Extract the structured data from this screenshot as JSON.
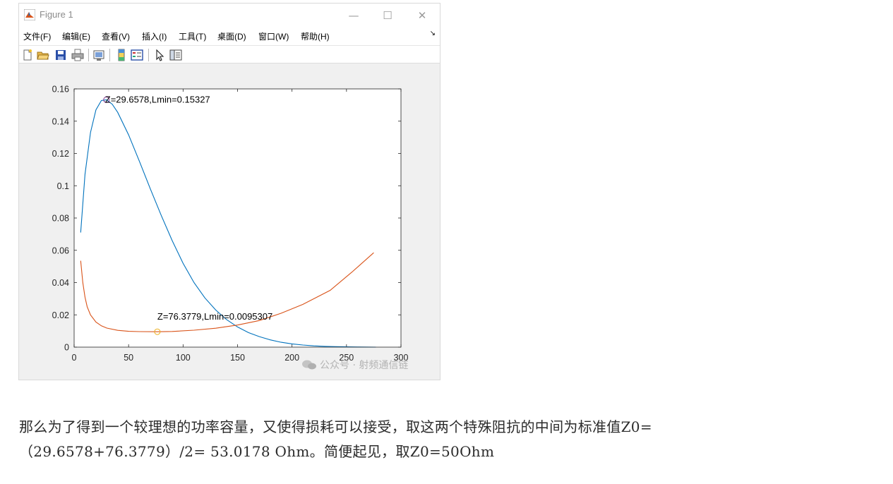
{
  "window": {
    "title": "Figure 1",
    "controls": {
      "minimize": "—",
      "maximize": "☐",
      "close": "✕"
    }
  },
  "menubar": {
    "items": [
      "文件(F)",
      "编辑(E)",
      "查看(V)",
      "插入(I)",
      "工具(T)",
      "桌面(D)",
      "窗口(W)",
      "帮助(H)"
    ],
    "dock_symbol": "↘"
  },
  "toolbar": {
    "icons": [
      "new-figure-icon",
      "open-file-icon",
      "save-icon",
      "print-icon",
      "link-plot-icon",
      "colorbar-icon",
      "legend-icon",
      "pointer-icon",
      "property-editor-icon"
    ]
  },
  "chart_data": {
    "type": "line",
    "title": "",
    "xlabel": "",
    "ylabel": "",
    "xlim": [
      0,
      300
    ],
    "ylim": [
      0,
      0.16
    ],
    "xticks": [
      "0",
      "50",
      "100",
      "150",
      "200",
      "250",
      "300"
    ],
    "yticks": [
      "0",
      "0.02",
      "0.04",
      "0.06",
      "0.08",
      "0.1",
      "0.12",
      "0.14",
      "0.16"
    ],
    "grid": false,
    "series": [
      {
        "color": "#0072bd",
        "x": [
          6,
          10,
          15,
          20,
          25,
          29.66,
          35,
          40,
          50,
          60,
          70,
          80,
          90,
          100,
          110,
          120,
          130,
          140,
          150,
          160,
          170,
          180,
          190,
          200,
          210,
          220,
          230,
          240,
          250,
          260,
          277
        ],
        "y": [
          0.071,
          0.107,
          0.133,
          0.147,
          0.1528,
          0.15327,
          0.1505,
          0.1455,
          0.1315,
          0.115,
          0.098,
          0.0815,
          0.066,
          0.052,
          0.04,
          0.0305,
          0.023,
          0.017,
          0.0125,
          0.009,
          0.0065,
          0.0045,
          0.003,
          0.002,
          0.0013,
          0.0008,
          0.0005,
          0.0003,
          0.0002,
          0.0001,
          0.0
        ]
      },
      {
        "color": "#d95319",
        "x": [
          6,
          8,
          10,
          12,
          15,
          20,
          25,
          30,
          40,
          50,
          60,
          76.38,
          90,
          110,
          130,
          150,
          170,
          190,
          210,
          235,
          255,
          275
        ],
        "y": [
          0.0535,
          0.04,
          0.031,
          0.025,
          0.02,
          0.0155,
          0.0132,
          0.0118,
          0.0104,
          0.0098,
          0.0096,
          0.0095307,
          0.0097,
          0.0105,
          0.0117,
          0.0137,
          0.0165,
          0.021,
          0.0265,
          0.0352,
          0.0465,
          0.0585
        ]
      }
    ],
    "markers": [
      {
        "x": 29.6578,
        "y": 0.15327,
        "color": "#7e2f8e",
        "label": "Z=29.6578,Lmin=0.15327"
      },
      {
        "x": 76.3779,
        "y": 0.0095307,
        "color": "#edb120",
        "label": "Z=76.3779,Lmin=0.0095307"
      }
    ]
  },
  "watermark": {
    "text": "公众号 · 射频通信链"
  },
  "article": {
    "line1": "那么为了得到一个较理想的功率容量，又使得损耗可以接受，取这两个特殊阻抗的中间为标准值Z0=",
    "line2": "（29.6578+76.3779）/2= 53.0178 Ohm。简便起见，取Z0=50Ohm"
  }
}
